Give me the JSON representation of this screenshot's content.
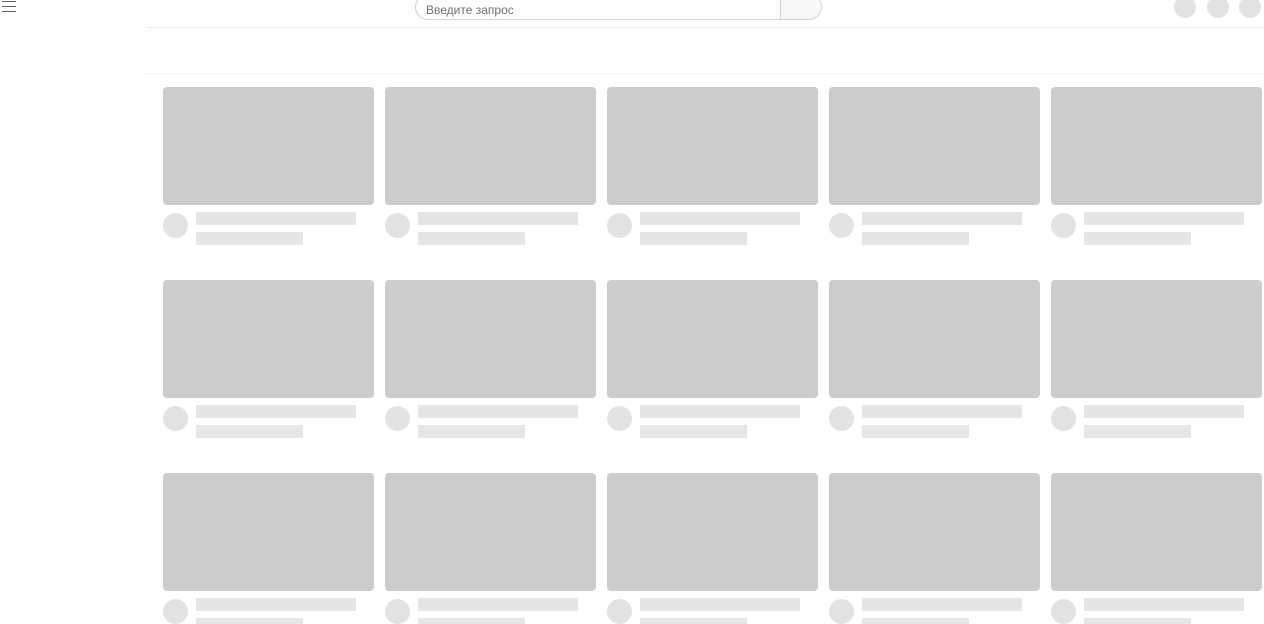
{
  "search": {
    "placeholder": "Введите запрос"
  },
  "colors": {
    "placeholder_block": "#cccccc",
    "skeleton_line": "#e6e6e6",
    "avatar": "#e3e3e3"
  },
  "grid": {
    "columns": 5,
    "rows": 3
  },
  "icons": {
    "menu": "hamburger-menu-icon",
    "header_actions": [
      "create-icon-placeholder",
      "notifications-icon-placeholder",
      "account-avatar-placeholder"
    ]
  }
}
